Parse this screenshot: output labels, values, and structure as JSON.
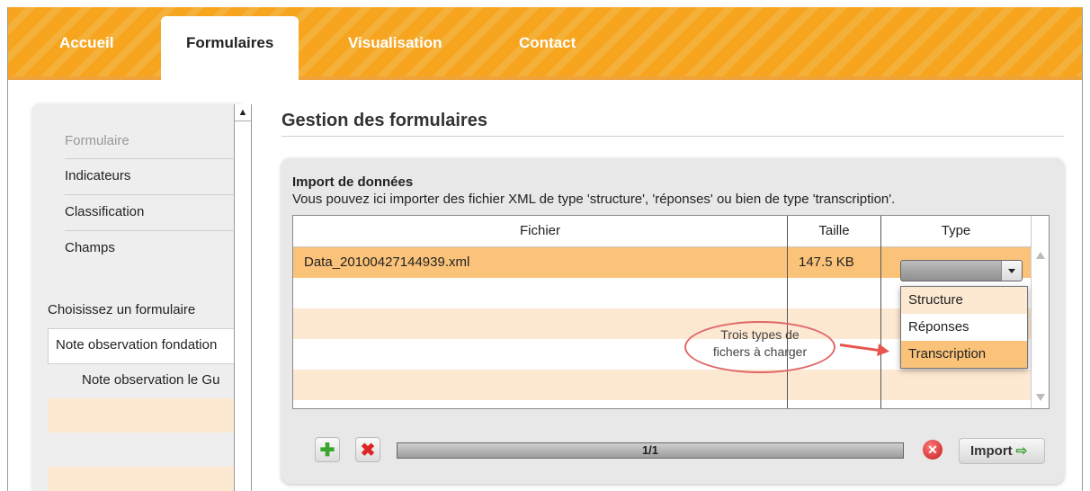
{
  "nav": {
    "tabs": [
      {
        "label": "Accueil"
      },
      {
        "label": "Formulaires"
      },
      {
        "label": "Visualisation"
      },
      {
        "label": "Contact"
      }
    ],
    "active": "Formulaires",
    "accent_color": "#f7a51f"
  },
  "sidebar": {
    "items": [
      {
        "label": "Formulaire",
        "state": "muted"
      },
      {
        "label": "Indicateurs"
      },
      {
        "label": "Classification"
      },
      {
        "label": "Champs"
      }
    ],
    "section_title": "Choisissez un formulaire",
    "forms": [
      {
        "label": "Note observation fondation"
      },
      {
        "label": "Note observation le Gu"
      }
    ]
  },
  "main": {
    "title": "Gestion des formulaires",
    "panel": {
      "title": "Import de données",
      "description": "Vous pouvez ici importer des fichier XML de type 'structure', 'réponses' ou bien de type 'transcription'.",
      "columns": [
        "Fichier",
        "Taille",
        "Type"
      ],
      "rows": [
        {
          "fichier": "Data_20100427144939.xml",
          "taille": "147.5 KB",
          "type": ""
        }
      ],
      "type_options": [
        "Structure",
        "Réponses",
        "Transcription"
      ],
      "highlighted_option": "Transcription",
      "progress_label": "1/1",
      "progress_fraction": 1.0,
      "import_label": "Import"
    },
    "annotation": {
      "line1": "Trois types de",
      "line2": "fichers à charger"
    }
  },
  "icons": {
    "add": "plus-icon",
    "delete": "x-icon",
    "cancel": "cancel-circle-icon",
    "import_arrow": "arrow-right-icon"
  },
  "colors": {
    "selected_row": "#fbc37a",
    "alt_row": "#fde8d2",
    "annotation": "#e8554e"
  }
}
